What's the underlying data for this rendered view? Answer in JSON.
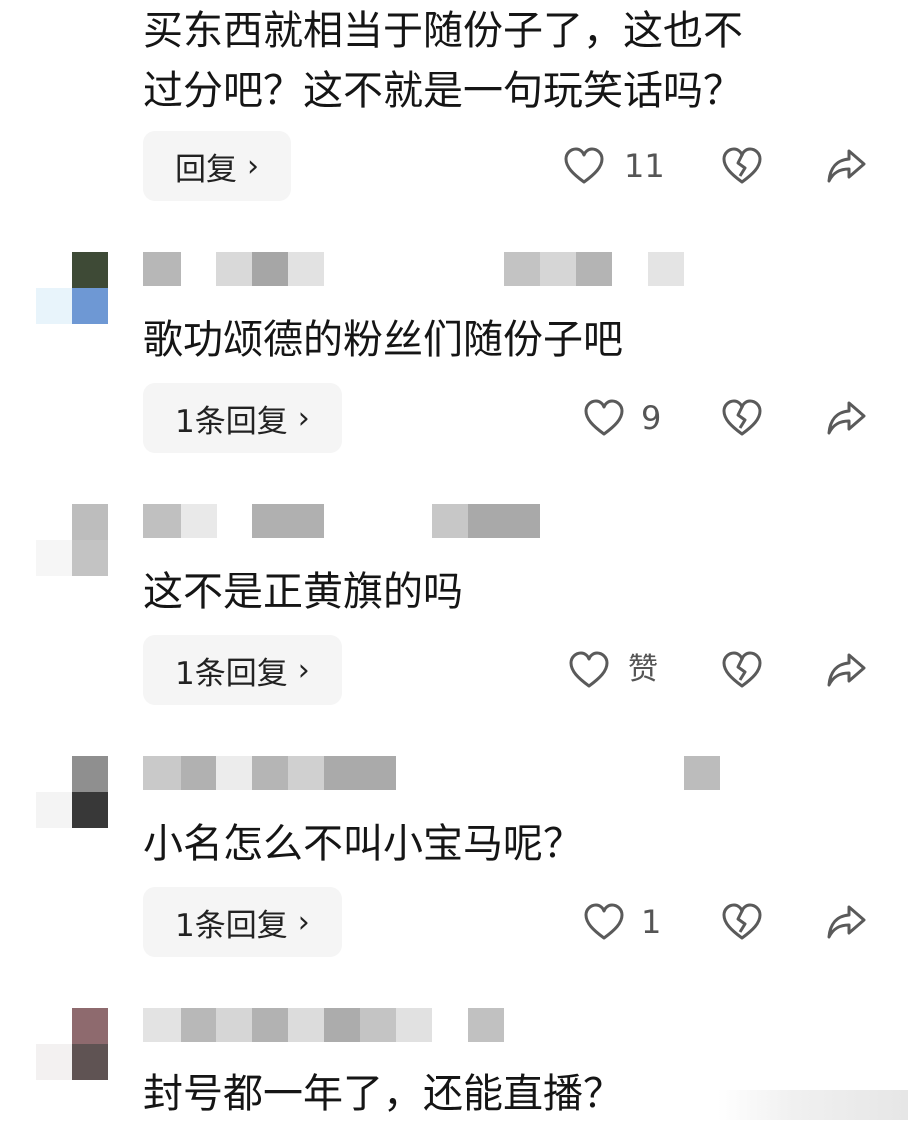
{
  "comments": [
    {
      "text_lines": [
        "买东西就相当于随份子了，这也不",
        "过分吧？这不就是一句玩笑话吗？"
      ],
      "reply_label": "回复",
      "like_count": "11"
    },
    {
      "text_lines": [
        "歌功颂德的粉丝们随份子吧"
      ],
      "reply_label": "1条回复",
      "like_count": "9"
    },
    {
      "text_lines": [
        "这不是正黄旗的吗"
      ],
      "reply_label": "1条回复",
      "like_count": "赞"
    },
    {
      "text_lines": [
        "小名怎么不叫小宝马呢？"
      ],
      "reply_label": "1条回复",
      "like_count": "1"
    },
    {
      "text_lines": [
        "封号都一年了，还能直播？"
      ]
    }
  ],
  "icons": {
    "like": "heart-icon",
    "dislike": "broken-heart-icon",
    "share": "share-arrow-icon",
    "reply_chevron": "chevron-right-icon"
  },
  "colors": {
    "icon_stroke": "#5a5a5a",
    "reply_bg": "#f5f5f5",
    "text": "#151515"
  }
}
